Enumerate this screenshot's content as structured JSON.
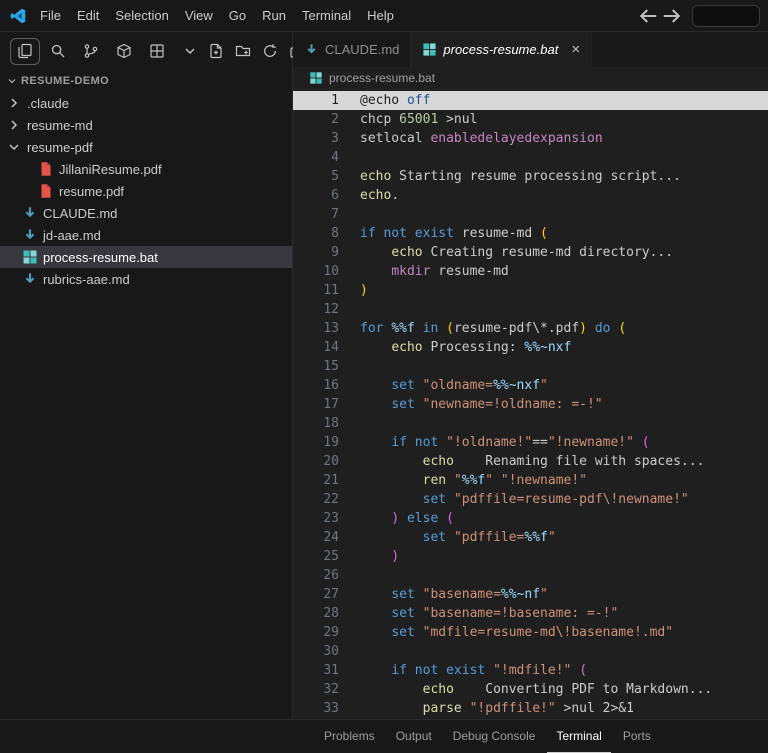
{
  "title_bar": {
    "logo_icon": "vscode-logo-icon",
    "menus": [
      "File",
      "Edit",
      "Selection",
      "View",
      "Go",
      "Run",
      "Terminal",
      "Help"
    ],
    "back_icon": "back-icon",
    "forward_icon": "forward-icon",
    "command_center": {
      "value": ""
    }
  },
  "sidebar": {
    "section": "RESUME-DEMO",
    "section_chevron": "chevron-down-icon",
    "activity_bar": {
      "items": [
        {
          "icon": "explorer-icon",
          "active": true
        },
        {
          "icon": "search-icon",
          "active": false
        },
        {
          "icon": "source-control-icon",
          "active": false
        },
        {
          "icon": "extensions-icon",
          "active": false
        },
        {
          "icon": "remote-grid-icon",
          "active": false
        },
        {
          "icon": "chevron-down-icon",
          "active": false
        }
      ],
      "actions": [
        "new-file-icon",
        "new-folder-icon",
        "refresh-icon",
        "collapse-all-icon"
      ]
    },
    "tree": [
      {
        "label": ".claude",
        "icon": "chevron-right-icon",
        "indent": 0,
        "selected": false
      },
      {
        "label": "resume-md",
        "icon": "chevron-right-icon",
        "indent": 0,
        "selected": false
      },
      {
        "label": "resume-pdf",
        "icon": "chevron-down-icon",
        "indent": 0,
        "selected": false
      },
      {
        "label": "JillaniResume.pdf",
        "icon": "pdf-icon",
        "indent": 2,
        "selected": false
      },
      {
        "label": "resume.pdf",
        "icon": "pdf-icon",
        "indent": 2,
        "selected": false
      },
      {
        "label": "CLAUDE.md",
        "icon": "md-icon",
        "indent": 1,
        "selected": false
      },
      {
        "label": "jd-aae.md",
        "icon": "md-icon",
        "indent": 1,
        "selected": false
      },
      {
        "label": "process-resume.bat",
        "icon": "bat-icon",
        "indent": 1,
        "selected": true
      },
      {
        "label": "rubrics-aae.md",
        "icon": "md-icon",
        "indent": 1,
        "selected": false
      }
    ]
  },
  "editor": {
    "tabs": [
      {
        "label": "CLAUDE.md",
        "icon": "md-icon",
        "active": false
      },
      {
        "label": "process-resume.bat",
        "icon": "bat-icon",
        "active": true,
        "close": "×"
      }
    ],
    "breadcrumb": {
      "icon": "bat-icon",
      "label": "process-resume.bat"
    },
    "lines": [
      {
        "n": 1,
        "hl": true,
        "s": [
          [
            "@echo ",
            "hd"
          ],
          [
            "off",
            "hk"
          ]
        ]
      },
      {
        "n": 2,
        "s": [
          [
            "chcp ",
            "d"
          ],
          [
            "65001",
            "n"
          ],
          [
            " >nul",
            "d"
          ]
        ]
      },
      {
        "n": 3,
        "s": [
          [
            "setlocal ",
            "d"
          ],
          [
            "enabledelayedexpansion",
            "p"
          ]
        ]
      },
      {
        "n": 4,
        "s": []
      },
      {
        "n": 5,
        "s": [
          [
            "echo ",
            "t"
          ],
          [
            "Starting resume processing script...",
            "d"
          ]
        ]
      },
      {
        "n": 6,
        "s": [
          [
            "echo",
            "t"
          ],
          [
            ".",
            "d"
          ]
        ]
      },
      {
        "n": 7,
        "s": []
      },
      {
        "n": 8,
        "s": [
          [
            "if ",
            "k"
          ],
          [
            "not ",
            "k"
          ],
          [
            "exist ",
            "k"
          ],
          [
            "resume-md ",
            "d"
          ],
          [
            "(",
            "g1"
          ]
        ]
      },
      {
        "n": 9,
        "s": [
          [
            "    ",
            "d"
          ],
          [
            "echo ",
            "t"
          ],
          [
            "Creating resume-md directory...",
            "d"
          ]
        ]
      },
      {
        "n": 10,
        "s": [
          [
            "    ",
            "d"
          ],
          [
            "mkdir ",
            "p"
          ],
          [
            "resume-md",
            "d"
          ]
        ]
      },
      {
        "n": 11,
        "s": [
          [
            ")",
            "g1"
          ]
        ]
      },
      {
        "n": 12,
        "s": []
      },
      {
        "n": 13,
        "s": [
          [
            "for ",
            "k"
          ],
          [
            "%%f",
            "v"
          ],
          [
            " ",
            "d"
          ],
          [
            "in ",
            "k"
          ],
          [
            "(",
            "g1"
          ],
          [
            "resume-pdf\\*.pdf",
            "d"
          ],
          [
            ")",
            "g1"
          ],
          [
            " ",
            "d"
          ],
          [
            "do ",
            "k"
          ],
          [
            "(",
            "g1"
          ]
        ]
      },
      {
        "n": 14,
        "s": [
          [
            "    ",
            "d"
          ],
          [
            "echo ",
            "t"
          ],
          [
            "Processing: ",
            "d"
          ],
          [
            "%%~nxf",
            "v"
          ]
        ]
      },
      {
        "n": 15,
        "s": []
      },
      {
        "n": 16,
        "s": [
          [
            "    ",
            "d"
          ],
          [
            "set ",
            "k"
          ],
          [
            "\"oldname=",
            "s"
          ],
          [
            "%%~nxf",
            "v"
          ],
          [
            "\"",
            "s"
          ]
        ]
      },
      {
        "n": 17,
        "s": [
          [
            "    ",
            "d"
          ],
          [
            "set ",
            "k"
          ],
          [
            "\"newname=!oldname: =-!\"",
            "s"
          ]
        ]
      },
      {
        "n": 18,
        "s": []
      },
      {
        "n": 19,
        "s": [
          [
            "    ",
            "d"
          ],
          [
            "if ",
            "k"
          ],
          [
            "not ",
            "k"
          ],
          [
            "\"!oldname!\"",
            "s"
          ],
          [
            "==",
            "d"
          ],
          [
            "\"!newname!\"",
            "s"
          ],
          [
            " ",
            "d"
          ],
          [
            "(",
            "g2"
          ]
        ]
      },
      {
        "n": 20,
        "s": [
          [
            "        ",
            "d"
          ],
          [
            "echo ",
            "t"
          ],
          [
            "   Renaming file with spaces...",
            "d"
          ]
        ]
      },
      {
        "n": 21,
        "s": [
          [
            "        ",
            "d"
          ],
          [
            "ren ",
            "t"
          ],
          [
            "\"",
            "s"
          ],
          [
            "%%f",
            "v"
          ],
          [
            "\"",
            "s"
          ],
          [
            " ",
            "d"
          ],
          [
            "\"!newname!\"",
            "s"
          ]
        ]
      },
      {
        "n": 22,
        "s": [
          [
            "        ",
            "d"
          ],
          [
            "set ",
            "k"
          ],
          [
            "\"pdffile=resume-pdf\\!newname!\"",
            "s"
          ]
        ]
      },
      {
        "n": 23,
        "s": [
          [
            "    ",
            "d"
          ],
          [
            ")",
            "g2"
          ],
          [
            " ",
            "d"
          ],
          [
            "else ",
            "k"
          ],
          [
            "(",
            "g2"
          ]
        ]
      },
      {
        "n": 24,
        "s": [
          [
            "        ",
            "d"
          ],
          [
            "set ",
            "k"
          ],
          [
            "\"pdffile=",
            "s"
          ],
          [
            "%%f",
            "v"
          ],
          [
            "\"",
            "s"
          ]
        ]
      },
      {
        "n": 25,
        "s": [
          [
            "    ",
            "d"
          ],
          [
            ")",
            "g2"
          ]
        ]
      },
      {
        "n": 26,
        "s": []
      },
      {
        "n": 27,
        "s": [
          [
            "    ",
            "d"
          ],
          [
            "set ",
            "k"
          ],
          [
            "\"basename=",
            "s"
          ],
          [
            "%%~nf",
            "v"
          ],
          [
            "\"",
            "s"
          ]
        ]
      },
      {
        "n": 28,
        "s": [
          [
            "    ",
            "d"
          ],
          [
            "set ",
            "k"
          ],
          [
            "\"basename=!basename: =-!\"",
            "s"
          ]
        ]
      },
      {
        "n": 29,
        "s": [
          [
            "    ",
            "d"
          ],
          [
            "set ",
            "k"
          ],
          [
            "\"mdfile=resume-md\\!basename!.md\"",
            "s"
          ]
        ]
      },
      {
        "n": 30,
        "s": []
      },
      {
        "n": 31,
        "s": [
          [
            "    ",
            "d"
          ],
          [
            "if ",
            "k"
          ],
          [
            "not ",
            "k"
          ],
          [
            "exist ",
            "k"
          ],
          [
            "\"!mdfile!\"",
            "s"
          ],
          [
            " ",
            "d"
          ],
          [
            "(",
            "g2"
          ]
        ]
      },
      {
        "n": 32,
        "s": [
          [
            "        ",
            "d"
          ],
          [
            "echo ",
            "t"
          ],
          [
            "   Converting PDF to Markdown...",
            "d"
          ]
        ]
      },
      {
        "n": 33,
        "s": [
          [
            "        ",
            "d"
          ],
          [
            "parse ",
            "t"
          ],
          [
            "\"!pdffile!\"",
            "s"
          ],
          [
            " >nul 2>&1",
            "d"
          ]
        ]
      }
    ]
  },
  "panel": {
    "tabs": [
      {
        "label": "Problems",
        "active": false
      },
      {
        "label": "Output",
        "active": false
      },
      {
        "label": "Debug Console",
        "active": false
      },
      {
        "label": "Terminal",
        "active": true
      },
      {
        "label": "Ports",
        "active": false
      }
    ]
  },
  "colors": {
    "bg": "#1f1f1f",
    "side": "#181818",
    "border": "#2b2b2b",
    "fg": "#cccccc",
    "dim": "#9d9d9d",
    "sel": "#37373d",
    "lnc": "#6e7681",
    "accent": "#0078d4",
    "tok_d": "#cccccc",
    "tok_k": "#569cd6",
    "tok_t": "#dcdcaa",
    "tok_p": "#c586c0",
    "tok_s": "#ce9178",
    "tok_v": "#9cdcfe",
    "tok_n": "#b5cea8",
    "tok_g1": "#ffd700",
    "tok_g2": "#da70d6",
    "hl_bg": "#d8d8d8",
    "hl_fg": "#1f1f1f",
    "hl_kw": "#1c4f93",
    "pdf_red": "#e5534b",
    "md_blue": "#519aba",
    "bat_teal": "#3fbdb8"
  }
}
